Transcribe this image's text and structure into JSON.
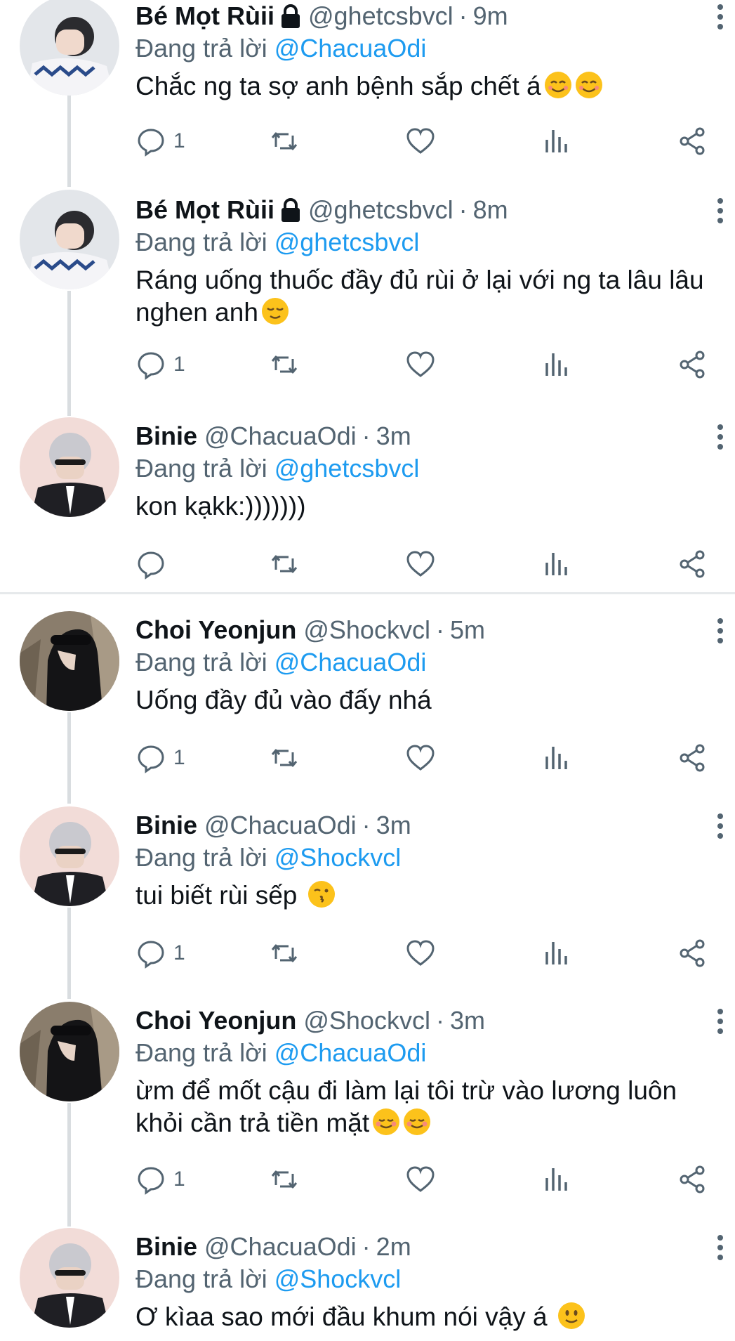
{
  "tweets": [
    {
      "name": "Bé Mọt Rùii",
      "locked": true,
      "handle": "@ghetcsbvcl",
      "separator": "·",
      "time": "9m",
      "reply_prefix": "Đang trả lời",
      "reply_to": "@ChacuaOdi",
      "text": "Chắc ng ta sợ anh bệnh sắp chết á",
      "emojis": [
        "smiling-face",
        "smiling-face"
      ],
      "reply_count": "1",
      "avatar": "avatar-girl"
    },
    {
      "name": "Bé Mọt Rùii",
      "locked": true,
      "handle": "@ghetcsbvcl",
      "separator": "·",
      "time": "8m",
      "reply_prefix": "Đang trả lời",
      "reply_to": "@ghetcsbvcl",
      "text_line1": "Ráng uống thuốc đầy đủ rùi ở lại với ng ta lâu lâu",
      "text_line2": "nghen anh",
      "emojis": [
        "relieved-face"
      ],
      "reply_count": "1",
      "avatar": "avatar-girl"
    },
    {
      "name": "Binie",
      "handle": "@ChacuaOdi",
      "separator": "·",
      "time": "3m",
      "reply_prefix": "Đang trả lời",
      "reply_to": "@ghetcsbvcl",
      "text": "kon kạkk:)))))))",
      "reply_count": "",
      "avatar": "avatar-binie"
    },
    {
      "name": "Choi Yeonjun",
      "handle": "@Shockvcl",
      "separator": "·",
      "time": "5m",
      "reply_prefix": "Đang trả lời",
      "reply_to": "@ChacuaOdi",
      "text": "Uống đầy đủ vào đấy nhá",
      "reply_count": "1",
      "avatar": "avatar-yeonjun"
    },
    {
      "name": "Binie",
      "handle": "@ChacuaOdi",
      "separator": "·",
      "time": "3m",
      "reply_prefix": "Đang trả lời",
      "reply_to": "@Shockvcl",
      "text": "tui biết rùi sếp",
      "emojis": [
        "kissing-face"
      ],
      "reply_count": "1",
      "avatar": "avatar-binie"
    },
    {
      "name": "Choi Yeonjun",
      "handle": "@Shockvcl",
      "separator": "·",
      "time": "3m",
      "reply_prefix": "Đang trả lời",
      "reply_to": "@ChacuaOdi",
      "text_line1": "ừm để mốt cậu đi làm lại tôi trừ vào lương luôn",
      "text_line2": "khỏi cần trả tiền mặt",
      "emojis": [
        "smiling-face-blush",
        "smiling-face-blush"
      ],
      "reply_count": "1",
      "avatar": "avatar-yeonjun"
    },
    {
      "name": "Binie",
      "handle": "@ChacuaOdi",
      "separator": "·",
      "time": "2m",
      "reply_prefix": "Đang trả lời",
      "reply_to": "@Shockvcl",
      "text": "Ơ kìaa sao mới đầu khum nói vậy á",
      "emojis": [
        "slightly-smiling-face"
      ],
      "avatar": "avatar-binie"
    }
  ],
  "icons": {
    "reply": "reply-icon",
    "retweet": "retweet-icon",
    "like": "like-icon",
    "views": "views-icon",
    "share": "share-icon",
    "more": "more-icon",
    "lock": "lock-icon"
  },
  "colors": {
    "link": "#1d9bf0",
    "secondary": "#536471",
    "text": "#0f1419",
    "thread_line": "#d9dde0"
  }
}
